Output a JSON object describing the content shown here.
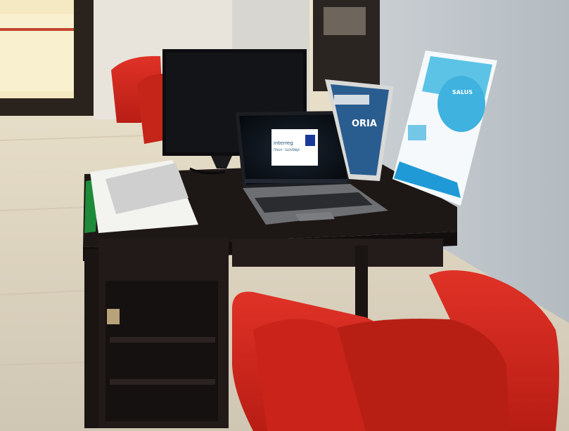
{
  "photo": {
    "laptop_screen": {
      "logo_text": "interreg",
      "logo_subtext": "ITALIA - SLOVENIJA"
    },
    "poster_center": {
      "visible_text": "ORIA"
    },
    "poster_right": {
      "title_text": "SALUS"
    }
  },
  "colors": {
    "wall": "#c9cfd3",
    "floor": "#d9cfbb",
    "desk": "#1d1716",
    "chair_red": "#d3261c",
    "poster_blue": "#3fb2df"
  }
}
